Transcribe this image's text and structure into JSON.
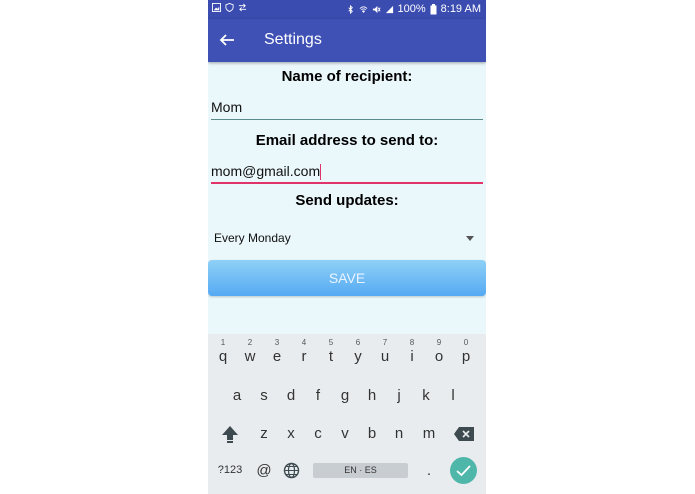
{
  "status_bar": {
    "battery": "100%",
    "time": "8:19 AM"
  },
  "app_bar": {
    "title": "Settings"
  },
  "form": {
    "recipient_label": "Name of recipient:",
    "recipient_value": "Mom",
    "email_label": "Email address to send to:",
    "email_value": "mom@gmail.com",
    "updates_label": "Send updates:",
    "updates_value": "Every Monday",
    "save_label": "SAVE"
  },
  "keyboard": {
    "row1": [
      "q",
      "w",
      "e",
      "r",
      "t",
      "y",
      "u",
      "i",
      "o",
      "p"
    ],
    "row1_numbers": [
      "1",
      "2",
      "3",
      "4",
      "5",
      "6",
      "7",
      "8",
      "9",
      "0"
    ],
    "row2": [
      "a",
      "s",
      "d",
      "f",
      "g",
      "h",
      "j",
      "k",
      "l"
    ],
    "row3": [
      "z",
      "x",
      "c",
      "v",
      "b",
      "n",
      "m"
    ],
    "sym_label": "?123",
    "at_label": "@",
    "space_label": "EN · ES",
    "period_label": "."
  },
  "colors": {
    "app_bar": "#3f51b5",
    "focus_underline": "#e0336a",
    "enter_key": "#4fb6aa"
  }
}
